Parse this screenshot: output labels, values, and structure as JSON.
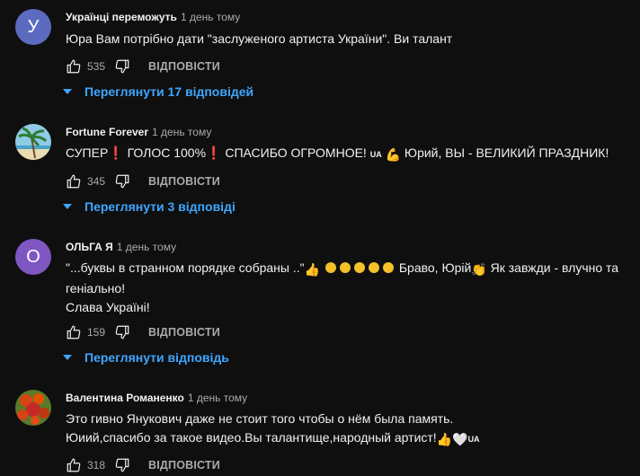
{
  "comments": [
    {
      "author": "Українці переможуть",
      "time": "1 день тому",
      "avatar_letter": "У",
      "avatar_color": "#5c6bc0",
      "lines": [
        "Юра Вам потрібно дати \"заслуженого артиста України\". Ви талант"
      ],
      "likes": "535",
      "reply_label": "ВІДПОВІСТИ",
      "replies_label": "Переглянути 17 відповідей"
    },
    {
      "author": "Fortune Forever",
      "time": "1 день тому",
      "avatar_letter": "",
      "avatar_color": "#7ab8d6",
      "text_parts": {
        "p1": "СУПЕР",
        "p2": " ГОЛОС 100%",
        "p3": " СПАСИБО ОГРОМНОЕ! ",
        "flag": "UA",
        "p4": " Юрий, ВЫ - ВЕЛИКИЙ ПРАЗДНИК!"
      },
      "likes": "345",
      "reply_label": "ВІДПОВІСТИ",
      "replies_label": "Переглянути 3 відповіді"
    },
    {
      "author": "ОЛЬГА Я",
      "time": "1 день тому",
      "avatar_letter": "О",
      "avatar_color": "#7e57c2",
      "text_parts": {
        "p1": "\"...буквы в странном порядке собраны ..\"",
        "p2": " Браво, Юрій",
        "p3": " Як завжди - влучно та",
        "line2": "геніально!",
        "line3": "Слава Україні!"
      },
      "likes": "159",
      "reply_label": "ВІДПОВІСТИ",
      "replies_label": "Переглянути відповідь"
    },
    {
      "author": "Валентина Романенко",
      "time": "1 день тому",
      "avatar_letter": "",
      "avatar_color": "#c0392b",
      "text_parts": {
        "line1": "Это гивно Янукович даже не стоит того чтобы о нём была память.",
        "line2": "Юиий,спасибо за такое видео.Вы талантище,народный артист!",
        "flag": "UA"
      },
      "likes": "318",
      "reply_label": "ВІДПОВІСТИ"
    }
  ],
  "icons": {
    "like": "thumbs-up-icon",
    "dislike": "thumbs-down-icon",
    "expand": "chevron-down-icon"
  },
  "colors": {
    "background": "#0f0f0f",
    "link": "#3ea6ff",
    "secondary_text": "#aaaaaa"
  }
}
